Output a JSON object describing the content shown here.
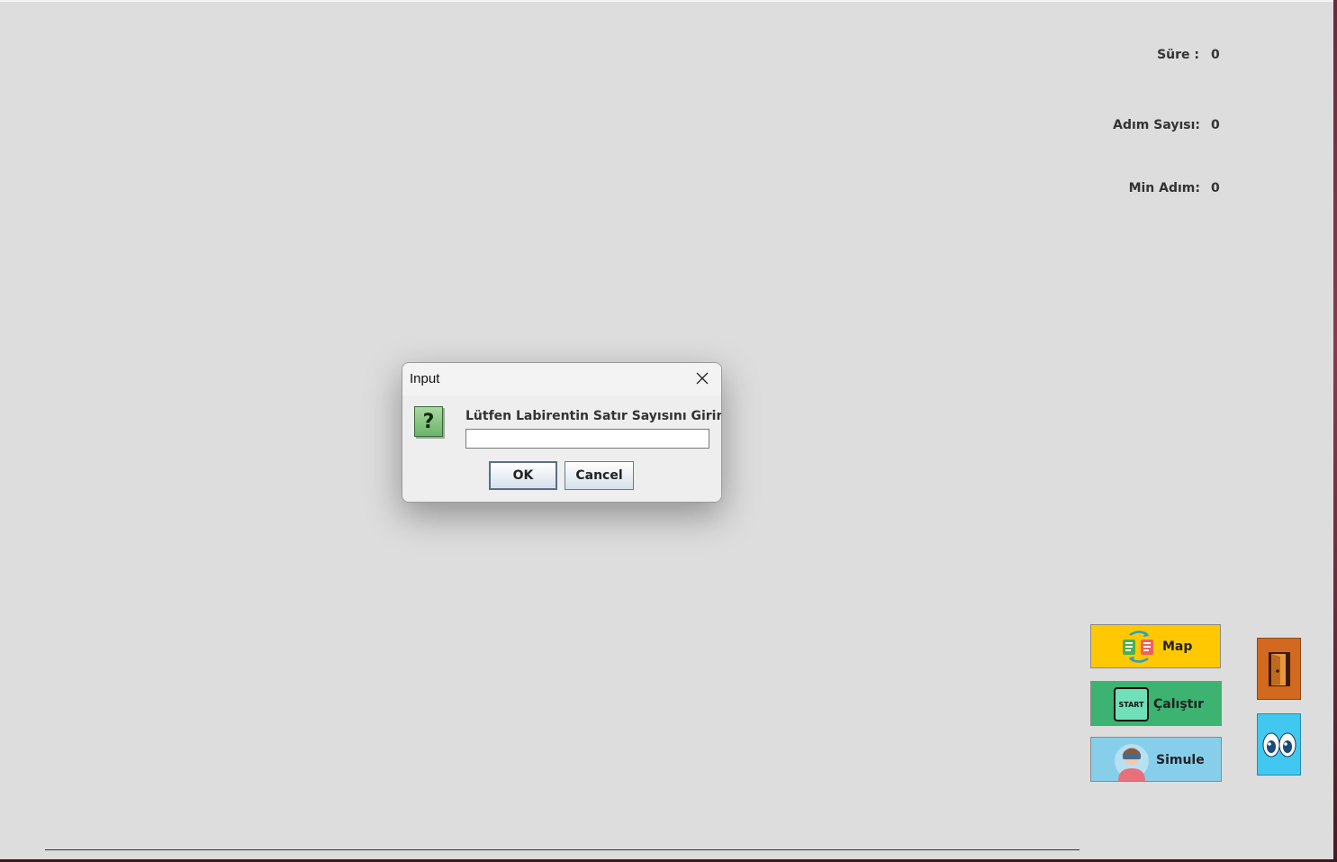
{
  "stats": [
    {
      "label": "Süre :",
      "value": "0"
    },
    {
      "label": "Adım Sayısı:",
      "value": "0"
    },
    {
      "label": "Min Adım:",
      "value": "0"
    }
  ],
  "buttons": {
    "map": "Map",
    "run": "Çalıştır",
    "run_icon_text": "START",
    "simulate": "Simule"
  },
  "dialog": {
    "title": "Input",
    "message": "Lütfen Labirentin Satır Sayısını Giriniz:",
    "input_value": "",
    "ok": "OK",
    "cancel": "Cancel"
  },
  "colors": {
    "map_button": "#ffc800",
    "run_button": "#3cb371",
    "simulate_button": "#87ceeb",
    "exit_button": "#d2691e",
    "view_button": "#40c8f0"
  },
  "icons": {
    "map": "map-swap-icon",
    "run": "start-sign-icon",
    "simulate": "vr-user-icon",
    "exit": "door-icon",
    "view": "eyes-icon",
    "dialog": "question-icon",
    "close": "close-icon"
  }
}
